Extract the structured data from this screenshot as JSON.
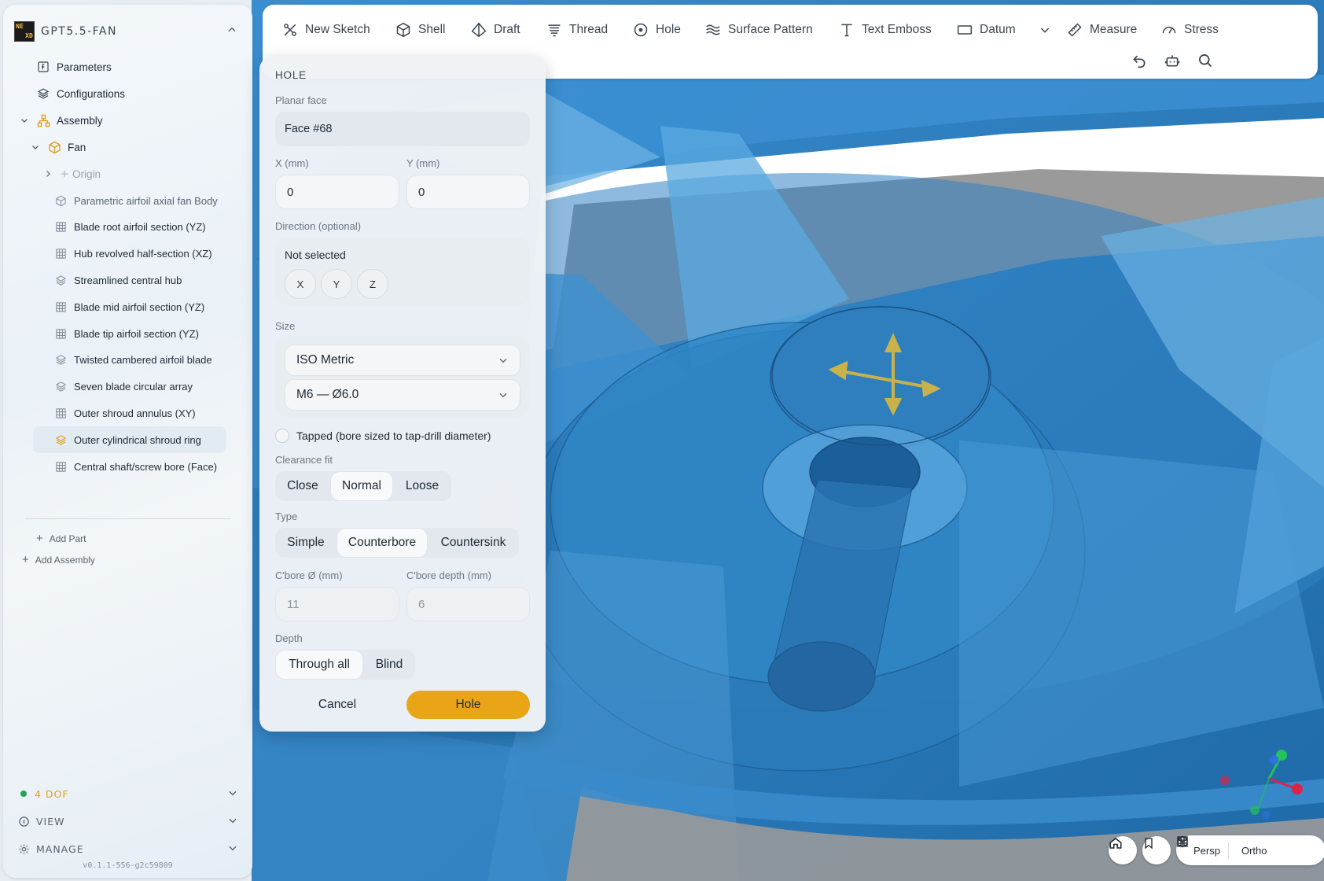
{
  "app": {
    "title": "GPT5.5-FAN",
    "logo_letters": [
      "NE",
      "",
      "",
      "XD"
    ]
  },
  "sidebar": {
    "parameters": "Parameters",
    "configurations": "Configurations",
    "assembly": "Assembly",
    "fan": "Fan",
    "origin": "Origin",
    "items": [
      {
        "label": "Parametric airfoil axial fan Body",
        "icon": "body-icon"
      },
      {
        "label": "Blade root airfoil section (YZ)",
        "icon": "sketch-grid-icon"
      },
      {
        "label": "Hub revolved half-section (XZ)",
        "icon": "sketch-grid-icon"
      },
      {
        "label": "Streamlined central hub",
        "icon": "feature-layers-icon"
      },
      {
        "label": "Blade mid airfoil section (YZ)",
        "icon": "sketch-grid-icon"
      },
      {
        "label": "Blade tip airfoil section (YZ)",
        "icon": "sketch-grid-icon"
      },
      {
        "label": "Twisted cambered airfoil blade",
        "icon": "feature-layers-icon"
      },
      {
        "label": "Seven blade circular array",
        "icon": "feature-layers-icon"
      },
      {
        "label": "Outer shroud annulus (XY)",
        "icon": "sketch-grid-icon"
      },
      {
        "label": "Outer cylindrical shroud ring",
        "icon": "feature-layers-icon"
      },
      {
        "label": "Central shaft/screw bore (Face)",
        "icon": "sketch-grid-icon"
      }
    ],
    "add_part": "Add Part",
    "add_assembly": "Add Assembly",
    "dof": "4 DOF",
    "view": "VIEW",
    "manage": "MANAGE",
    "version": "v0.1.1-556-g2c59809"
  },
  "toolbar": {
    "tools": [
      {
        "label": "New Sketch",
        "icon": "sketch-icon"
      },
      {
        "label": "Shell",
        "icon": "shell-icon"
      },
      {
        "label": "Draft",
        "icon": "draft-icon"
      },
      {
        "label": "Thread",
        "icon": "thread-icon"
      },
      {
        "label": "Hole",
        "icon": "hole-icon"
      },
      {
        "label": "Surface Pattern",
        "icon": "surface-pattern-icon"
      },
      {
        "label": "Text Emboss",
        "icon": "text-icon"
      },
      {
        "label": "Datum",
        "icon": "datum-icon"
      },
      {
        "label": "Measure",
        "icon": "ruler-icon"
      },
      {
        "label": "Stress",
        "icon": "gauge-icon"
      }
    ]
  },
  "hole_panel": {
    "title": "HOLE",
    "planar_face_label": "Planar face",
    "planar_face_value": "Face #68",
    "x_label": "X (mm)",
    "x_value": "0",
    "y_label": "Y (mm)",
    "y_value": "0",
    "direction_label": "Direction (optional)",
    "direction_value": "Not selected",
    "axes": [
      "X",
      "Y",
      "Z"
    ],
    "size_label": "Size",
    "standard": "ISO Metric",
    "size": "M6 — Ø6.0",
    "tapped_label": "Tapped (bore sized to tap-drill diameter)",
    "clearance_label": "Clearance fit",
    "clearance_options": [
      "Close",
      "Normal",
      "Loose"
    ],
    "clearance_selected": "Normal",
    "type_label": "Type",
    "type_options": [
      "Simple",
      "Counterbore",
      "Countersink"
    ],
    "type_selected": "Counterbore",
    "cbore_dia_label": "C'bore Ø (mm)",
    "cbore_dia_value": "11",
    "cbore_depth_label": "C'bore depth (mm)",
    "cbore_depth_value": "6",
    "depth_label": "Depth",
    "depth_options": [
      "Through all",
      "Blind"
    ],
    "depth_selected": "Through all",
    "cancel": "Cancel",
    "submit": "Hole"
  },
  "view_controls": {
    "persp": "Persp",
    "ortho": "Ortho"
  },
  "colors": {
    "accent": "#eaa516",
    "model": "#2e7fbe",
    "dof_dot": "#22a35a"
  }
}
